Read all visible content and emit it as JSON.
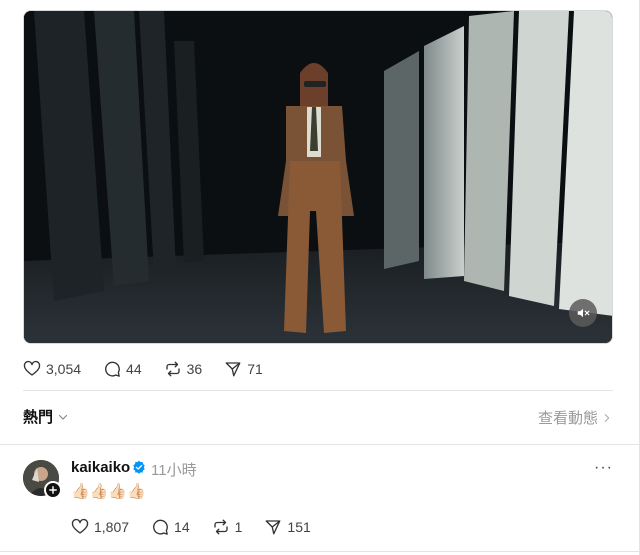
{
  "post": {
    "video": {
      "muted": true,
      "icon": "volume-muted-icon"
    },
    "likes": "3,054",
    "replies": "44",
    "reposts": "36",
    "shares": "71"
  },
  "replies_bar": {
    "sort_label": "熱門",
    "view_activity_label": "查看動態"
  },
  "reply": {
    "username": "kaikaiko",
    "verified": true,
    "time": "11小時",
    "more": "···",
    "text": "👍🏻👍🏻👍🏻👍🏻",
    "likes": "1,807",
    "replies": "14",
    "reposts": "1",
    "shares": "151"
  },
  "colors": {
    "verified_blue": "#0095f6",
    "muted_text": "#999999",
    "divider": "#e4e4e4"
  }
}
